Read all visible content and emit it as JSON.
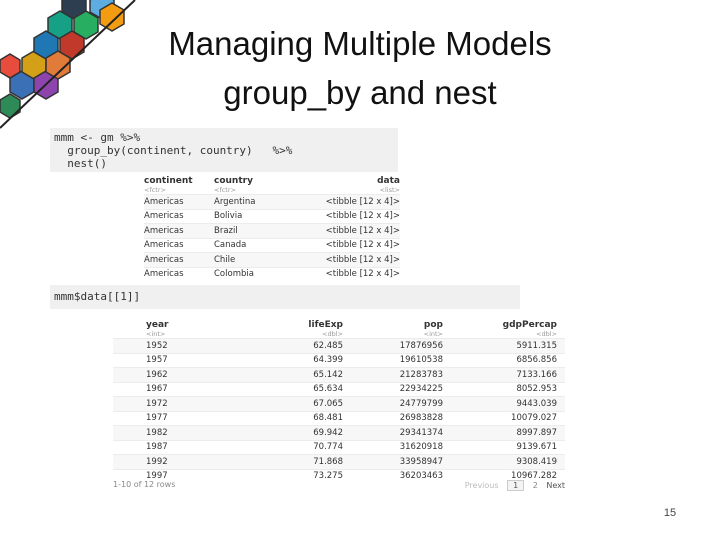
{
  "slide": {
    "title_line1": "Managing Multiple Models",
    "title_line2": "group_by and nest",
    "number": "15"
  },
  "code1": {
    "line1": "mmm <- gm %>%",
    "line2": "  group_by(continent, country)   %>%",
    "line3": "  nest()"
  },
  "code2": {
    "line1": "mmm$data[[1]]"
  },
  "table1": {
    "columns": [
      "continent",
      "country",
      "data"
    ],
    "types": [
      "<fctr>",
      "<fctr>",
      "<list>"
    ],
    "rows": [
      [
        "Americas",
        "Argentina",
        "<tibble [12 x 4]>"
      ],
      [
        "Americas",
        "Bolivia",
        "<tibble [12 x 4]>"
      ],
      [
        "Americas",
        "Brazil",
        "<tibble [12 x 4]>"
      ],
      [
        "Americas",
        "Canada",
        "<tibble [12 x 4]>"
      ],
      [
        "Americas",
        "Chile",
        "<tibble [12 x 4]>"
      ],
      [
        "Americas",
        "Colombia",
        "<tibble [12 x 4]>"
      ]
    ]
  },
  "table2": {
    "columns": [
      "year",
      "lifeExp",
      "pop",
      "gdpPercap"
    ],
    "types": [
      "<int>",
      "<dbl>",
      "<int>",
      "<dbl>"
    ],
    "rows": [
      [
        "1952",
        "62.485",
        "17876956",
        "5911.315"
      ],
      [
        "1957",
        "64.399",
        "19610538",
        "6856.856"
      ],
      [
        "1962",
        "65.142",
        "21283783",
        "7133.166"
      ],
      [
        "1967",
        "65.634",
        "22934225",
        "8052.953"
      ],
      [
        "1972",
        "67.065",
        "24779799",
        "9443.039"
      ],
      [
        "1977",
        "68.481",
        "26983828",
        "10079.027"
      ],
      [
        "1982",
        "69.942",
        "29341374",
        "8997.897"
      ],
      [
        "1987",
        "70.774",
        "31620918",
        "9139.671"
      ],
      [
        "1992",
        "71.868",
        "33958947",
        "9308.419"
      ],
      [
        "1997",
        "73.275",
        "36203463",
        "10967.282"
      ]
    ],
    "footer": "1-10 of 12 rows",
    "pager": {
      "previous": "Previous",
      "page1": "1",
      "page2": "2",
      "next": "Next"
    }
  }
}
